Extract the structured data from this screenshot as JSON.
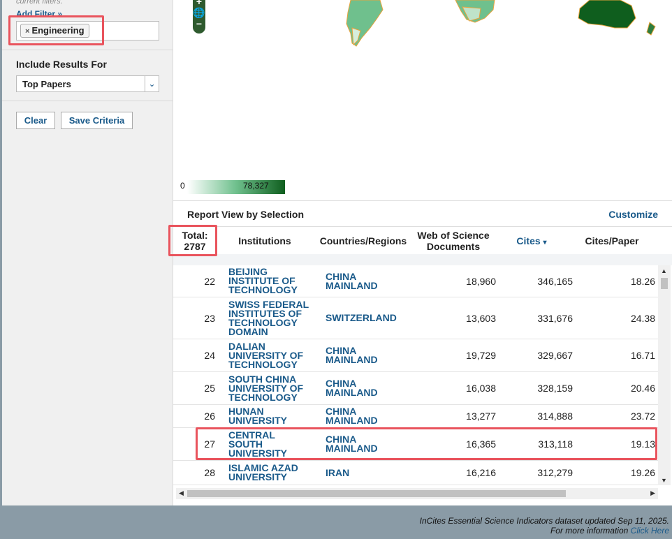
{
  "sidebar": {
    "note": "current filters.",
    "add_filter_label": "Add Filter »",
    "filter_chip_remove": "×",
    "filter_chip_label": "Engineering",
    "include_title": "Include Results For",
    "include_selected": "Top Papers",
    "clear_label": "Clear",
    "save_label": "Save Criteria"
  },
  "map": {
    "zoom_in": "+",
    "zoom_out": "−",
    "legend_min": "0",
    "legend_max": "78,327",
    "colors": {
      "dark": "#0f5e1e",
      "mid": "#6fc08d",
      "light": "#e6f4ea",
      "border": "#e8a33d"
    }
  },
  "report": {
    "title": "Report View by Selection",
    "customize_label": "Customize",
    "headers": {
      "total_line1": "Total:",
      "total_line2": "2787",
      "institutions": "Institutions",
      "countries": "Countries/Regions",
      "docs_line1": "Web of Science",
      "docs_line2": "Documents",
      "cites": "Cites",
      "cites_sort": "▾",
      "cites_per_paper": "Cites/Paper"
    },
    "rows": [
      {
        "rank": "22",
        "inst": [
          "BEIJING",
          "INSTITUTE OF",
          "TECHNOLOGY"
        ],
        "country": [
          "CHINA",
          "MAINLAND"
        ],
        "docs": "18,960",
        "cites": "346,165",
        "cpp": "18.26"
      },
      {
        "rank": "23",
        "inst": [
          "SWISS FEDERAL",
          "INSTITUTES OF",
          "TECHNOLOGY",
          "DOMAIN"
        ],
        "country": [
          "SWITZERLAND"
        ],
        "docs": "13,603",
        "cites": "331,676",
        "cpp": "24.38"
      },
      {
        "rank": "24",
        "inst": [
          "DALIAN",
          "UNIVERSITY OF",
          "TECHNOLOGY"
        ],
        "country": [
          "CHINA",
          "MAINLAND"
        ],
        "docs": "19,729",
        "cites": "329,667",
        "cpp": "16.71"
      },
      {
        "rank": "25",
        "inst": [
          "SOUTH CHINA",
          "UNIVERSITY OF",
          "TECHNOLOGY"
        ],
        "country": [
          "CHINA",
          "MAINLAND"
        ],
        "docs": "16,038",
        "cites": "328,159",
        "cpp": "20.46"
      },
      {
        "rank": "26",
        "inst": [
          "HUNAN",
          "UNIVERSITY"
        ],
        "country": [
          "CHINA",
          "MAINLAND"
        ],
        "docs": "13,277",
        "cites": "314,888",
        "cpp": "23.72"
      },
      {
        "rank": "27",
        "inst": [
          "CENTRAL",
          "SOUTH",
          "UNIVERSITY"
        ],
        "country": [
          "CHINA",
          "MAINLAND"
        ],
        "docs": "16,365",
        "cites": "313,118",
        "cpp": "19.13"
      },
      {
        "rank": "28",
        "inst": [
          "ISLAMIC AZAD",
          "UNIVERSITY"
        ],
        "country": [
          "IRAN"
        ],
        "docs": "16,216",
        "cites": "312,279",
        "cpp": "19.26"
      }
    ]
  },
  "footer": {
    "line1": "InCites Essential Science Indicators dataset updated Sep 11, 2025.",
    "line2": "For more information",
    "link": "Click Here"
  }
}
